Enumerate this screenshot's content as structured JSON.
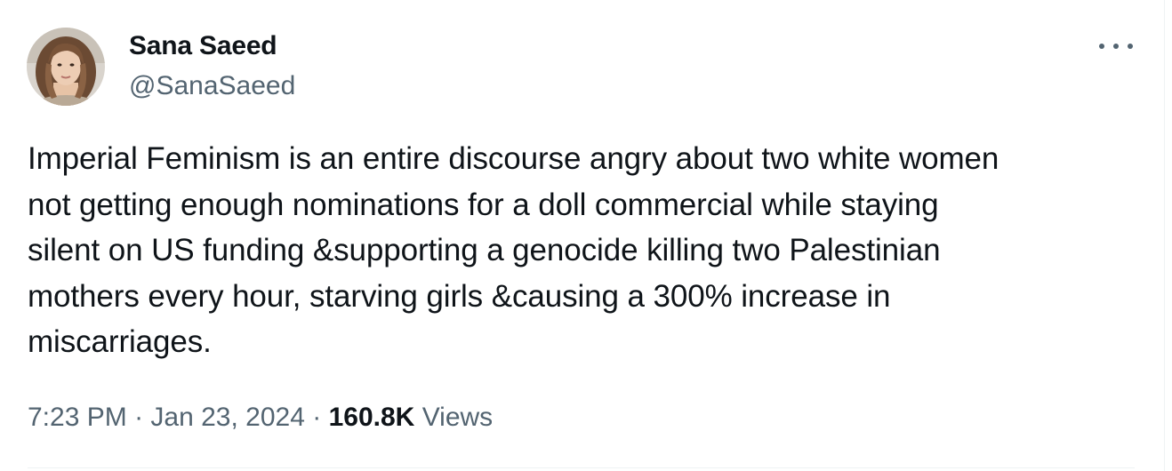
{
  "author": {
    "display_name": "Sana Saeed",
    "handle": "@SanaSaeed"
  },
  "menu": {
    "icon": "more-horizontal-icon"
  },
  "tweet": {
    "text_lines": [
      "Imperial Feminism is an entire discourse angry about two white women",
      "not getting enough nominations for a doll commercial while staying",
      "silent on US funding &supporting a genocide killing two Palestinian",
      "mothers every hour, starving girls &causing a 300% increase in",
      "miscarriages."
    ]
  },
  "meta": {
    "time": "7:23 PM",
    "separator": "·",
    "date": "Jan 23, 2024",
    "views_count": "160.8K",
    "views_label": "Views"
  },
  "colors": {
    "primary_text": "#0f1419",
    "secondary_text": "#536471",
    "border": "#eff3f4"
  }
}
